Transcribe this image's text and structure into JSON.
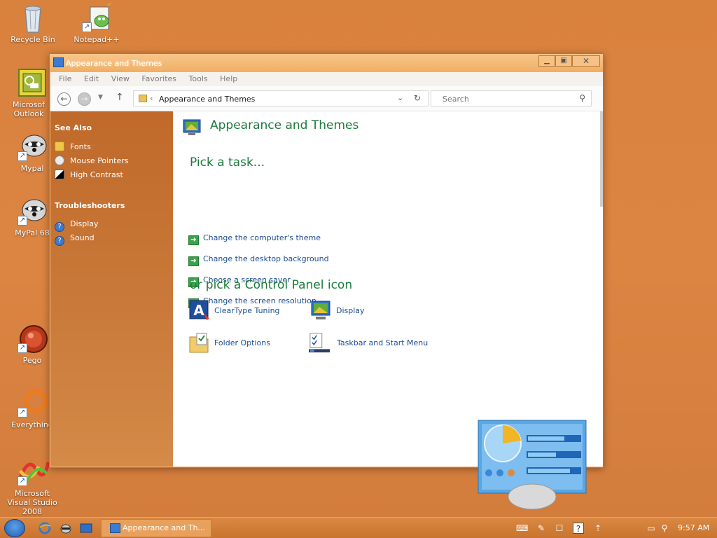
{
  "desktop": {
    "icons": [
      {
        "label": "Recycle Bin"
      },
      {
        "label": "Notepad++"
      },
      {
        "label": "Microsof Outlook"
      },
      {
        "label": "Mypal"
      },
      {
        "label": "MyPal 68"
      },
      {
        "label": "Pego"
      },
      {
        "label": "Everything"
      },
      {
        "label": "Microsoft Visual Studio 2008"
      }
    ]
  },
  "window": {
    "title": "Appearance and Themes",
    "menu": [
      "File",
      "Edit",
      "View",
      "Favorites",
      "Tools",
      "Help"
    ],
    "address": {
      "separator": "‹",
      "path": "Appearance and Themes"
    },
    "search": {
      "placeholder": "Search"
    },
    "sidebar": {
      "see_also_title": "See Also",
      "see_also": [
        "Fonts",
        "Mouse Pointers",
        "High Contrast"
      ],
      "troubleshooters_title": "Troubleshooters",
      "troubleshooters": [
        "Display",
        "Sound"
      ]
    },
    "content": {
      "title": "Appearance and Themes",
      "pick_task": "Pick a task...",
      "tasks": [
        "Change the computer's theme",
        "Change the desktop background",
        "Choose a screen saver",
        "Change the screen resolution"
      ],
      "pick_icon": "or pick a Control Panel icon",
      "icons": [
        "ClearType Tuning",
        "Display",
        "Folder Options",
        "Taskbar and Start Menu"
      ]
    }
  },
  "taskbar": {
    "active_task": "Appearance and Th...",
    "clock": "9:57 AM"
  },
  "colors": {
    "desktop": "#dc8442",
    "sidebar": "#c97a3a",
    "heading_green": "#1c7a3c",
    "link_blue": "#1a4d8f"
  }
}
